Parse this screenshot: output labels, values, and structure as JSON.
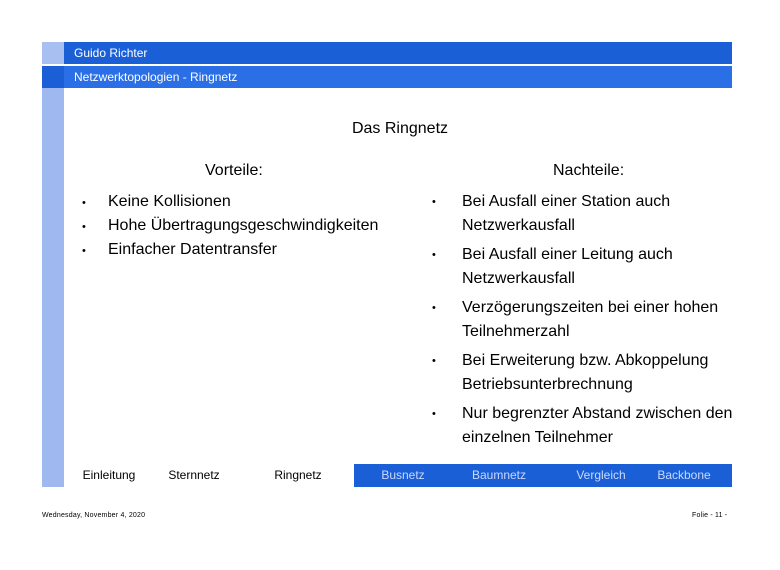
{
  "header": {
    "author": "Guido Richter",
    "subtitle": "Netzwerktopologien - Ringnetz"
  },
  "slide": {
    "title": "Das Ringnetz",
    "advantages_heading": "Vorteile:",
    "disadvantages_heading": "Nachteile:",
    "advantages": [
      "Keine Kollisionen",
      "Hohe Übertragungsgeschwindigkeiten",
      "Einfacher Datentransfer"
    ],
    "disadvantages": [
      "Bei Ausfall einer Station auch Netzwerkausfall",
      "Bei Ausfall einer Leitung auch Netzwerkausfall",
      "Verzögerungszeiten bei einer hohen Teilnehmerzahl",
      "Bei Erweiterung bzw. Abkoppelung Betriebsunterbrechnung",
      "Nur begrenzter Abstand zwischen den einzelnen Teilnehmer"
    ],
    "bullet_glyph": "•"
  },
  "nav": {
    "items": [
      "Einleitung",
      "Sternnetz",
      "Ringnetz",
      "Busnetz",
      "Baumnetz",
      "Vergleich",
      "Backbone"
    ]
  },
  "footer": {
    "date": "Wednesday, November 4, 2020",
    "slide_number": "Folie - 11 -"
  },
  "colors": {
    "primary_blue": "#1a5fd6",
    "stripe_light_blue": "#9fb8ef"
  }
}
